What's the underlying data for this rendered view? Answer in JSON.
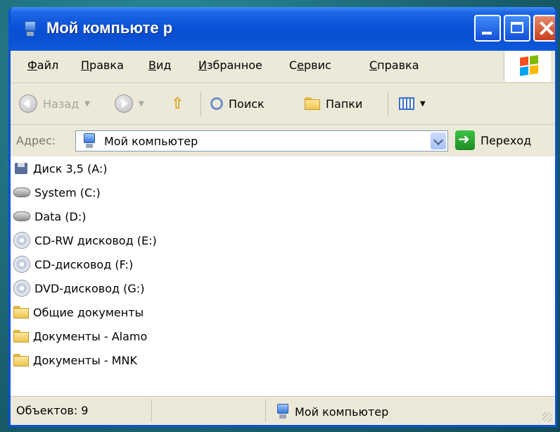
{
  "window": {
    "title": "Мой компьюте р"
  },
  "menu": {
    "items": [
      {
        "label": "Файл",
        "accel": "Ф"
      },
      {
        "label": "Правка",
        "accel": "П"
      },
      {
        "label": "Вид",
        "accel": "В"
      },
      {
        "label": "Избранное",
        "accel": "И"
      },
      {
        "label": "Сервис",
        "accel": "е"
      },
      {
        "label": "Справка",
        "accel": "С"
      }
    ]
  },
  "toolbar": {
    "back_label": "Назад",
    "search_label": "Поиск",
    "folders_label": "Папки"
  },
  "address": {
    "label": "Адрес:",
    "value": "Мой компьютер",
    "go_label": "Переход"
  },
  "items": [
    {
      "label": "Диск 3,5 (A:)",
      "icon": "floppy-drive-icon"
    },
    {
      "label": "System (C:)",
      "icon": "hard-drive-icon"
    },
    {
      "label": "Data (D:)",
      "icon": "hard-drive-icon"
    },
    {
      "label": "CD-RW дисковод (E:)",
      "icon": "cd-drive-icon"
    },
    {
      "label": "CD-дисковод (F:)",
      "icon": "cd-drive-icon"
    },
    {
      "label": "DVD-дисковод (G:)",
      "icon": "cd-drive-icon"
    },
    {
      "label": "Общие документы",
      "icon": "folder-icon"
    },
    {
      "label": "Документы - Alamo",
      "icon": "folder-icon"
    },
    {
      "label": "Документы - MNK",
      "icon": "folder-icon"
    }
  ],
  "status": {
    "objects": "Объектов: 9",
    "location": "Мой компьютер"
  },
  "colors": {
    "titlebar": "#0b52d6",
    "window_bg": "#ece9d8",
    "close_button": "#c9401c",
    "desktop": "#1b6473"
  }
}
